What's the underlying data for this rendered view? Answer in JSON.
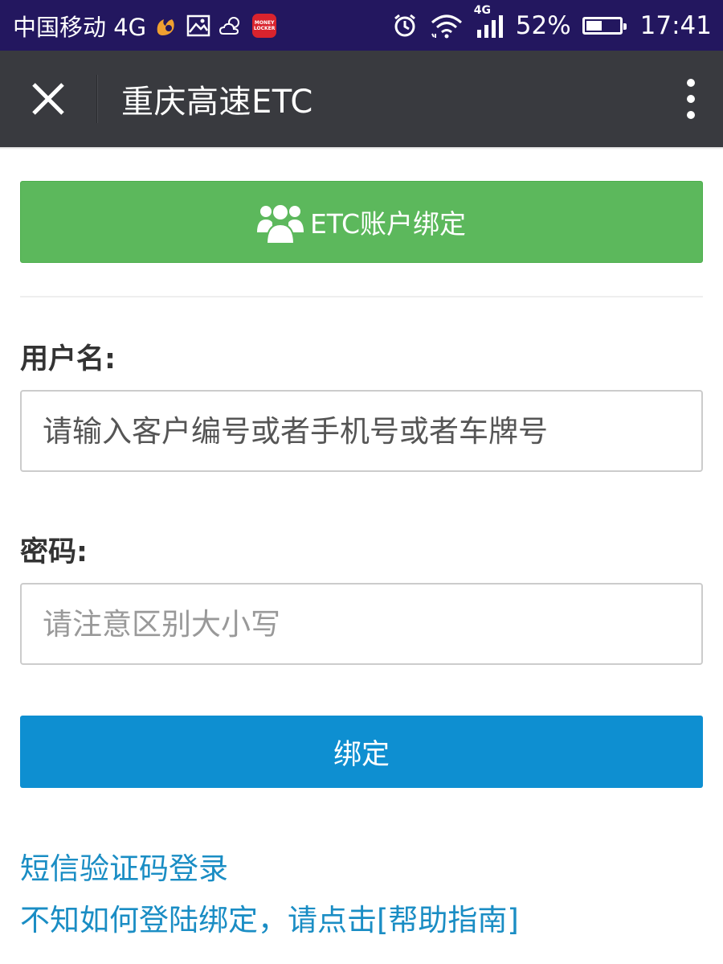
{
  "status_bar": {
    "carrier": "中国移动 4G",
    "network_badge": "4G",
    "battery": "52%",
    "battery_level": 0.52,
    "time": "17:41",
    "app_badge_text": "MONEY LOCKER",
    "icons": [
      "uc-browser-icon",
      "gallery-icon",
      "weather-icon",
      "money-locker-icon",
      "alarm-icon",
      "wifi-icon",
      "signal-icon",
      "battery-icon"
    ]
  },
  "title_bar": {
    "title": "重庆高速ETC",
    "close_icon": "close-icon",
    "more_icon": "more-vertical-icon"
  },
  "bind_header": {
    "label": "ETC账户绑定",
    "icon": "users-icon",
    "color": "#5cb85c"
  },
  "form": {
    "username_label": "用户名:",
    "username_placeholder": "请输入客户编号或者手机号或者车牌号",
    "password_label": "密码:",
    "password_placeholder": "请注意区别大小写",
    "submit_label": "绑定",
    "submit_color": "#0e8fd1"
  },
  "links": {
    "sms_login": "短信验证码登录",
    "help": "不知如何登陆绑定，请点击[帮助指南]",
    "color": "#1a8dc4"
  }
}
